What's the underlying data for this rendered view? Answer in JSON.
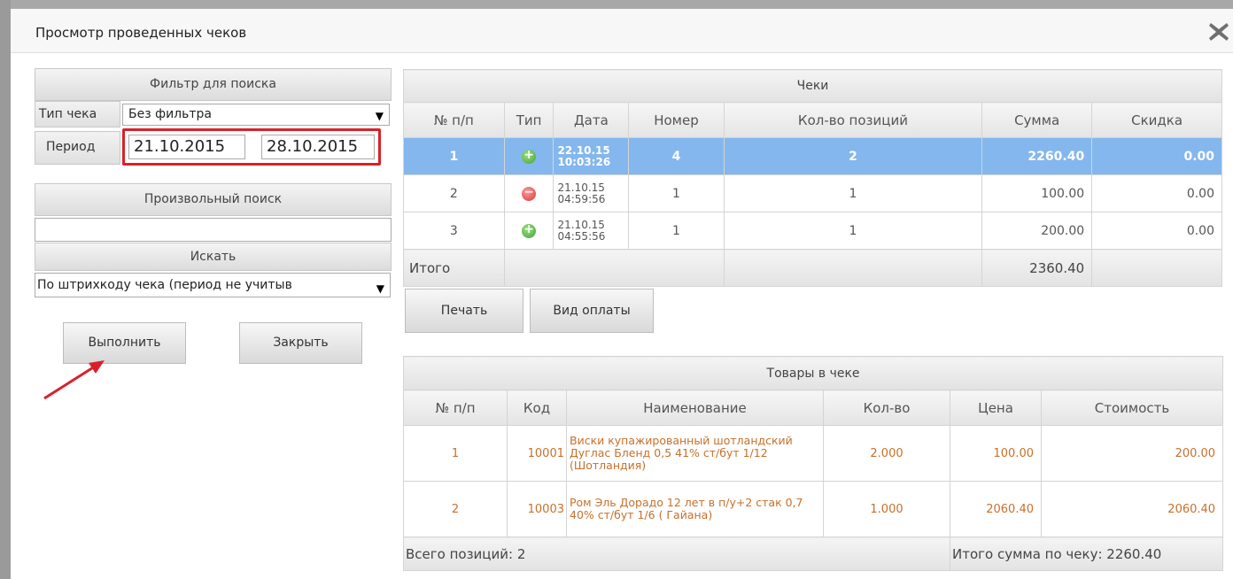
{
  "window": {
    "title": "Просмотр проведенных чеков",
    "close_icon": "close-x-icon"
  },
  "filter": {
    "header": "Фильтр для поиска",
    "type_label": "Тип чека",
    "type_value": "Без фильтра",
    "period_label": "Период",
    "date_from": "21.10.2015",
    "date_to": "28.10.2015",
    "free_search_header": "Произвольный поиск",
    "free_search_value": "",
    "search_by_header": "Искать",
    "search_by_value": "По штрихкоду чека (период не учитыв",
    "execute_button": "Выполнить",
    "close_button": "Закрыть"
  },
  "receipts": {
    "caption": "Чеки",
    "columns": [
      "№ п/п",
      "Тип",
      "Дата",
      "Номер",
      "Кол-во позиций",
      "Сумма",
      "Скидка"
    ],
    "rows": [
      {
        "n": "1",
        "type": "plus",
        "date": "22.10.15",
        "time": "10:03:26",
        "number": "4",
        "positions": "2",
        "sum": "2260.40",
        "discount": "0.00",
        "selected": true
      },
      {
        "n": "2",
        "type": "minus",
        "date": "21.10.15",
        "time": "04:59:56",
        "number": "1",
        "positions": "1",
        "sum": "100.00",
        "discount": "0.00",
        "selected": false
      },
      {
        "n": "3",
        "type": "plus",
        "date": "21.10.15",
        "time": "04:55:56",
        "number": "1",
        "positions": "1",
        "sum": "200.00",
        "discount": "0.00",
        "selected": false
      }
    ],
    "total_label": "Итого",
    "total_sum": "2360.40",
    "print_button": "Печать",
    "payment_button": "Вид оплаты"
  },
  "goods": {
    "caption": "Товары в чеке",
    "columns": [
      "№ п/п",
      "Код",
      "Наименование",
      "Кол-во",
      "Цена",
      "Стоимость"
    ],
    "rows": [
      {
        "n": "1",
        "code": "10001",
        "name": "Виски купажированный шотландский Дуглас Бленд 0,5 41% ст/бут 1/12 (Шотландия)",
        "qty": "2.000",
        "price": "100.00",
        "cost": "200.00"
      },
      {
        "n": "2",
        "code": "10003",
        "name": "Ром Эль Дорадо 12 лет в п/у+2 стак 0,7 40% ст/бут 1/6 ( Гайана)",
        "qty": "1.000",
        "price": "2060.40",
        "cost": "2060.40"
      }
    ],
    "total_positions": "Всего позиций: 2",
    "total_sum": "Итого сумма по чеку: 2260.40"
  },
  "colors": {
    "selected_row": "#84b7ee",
    "highlight": "#d9202a",
    "goods_text": "#c8702a"
  }
}
